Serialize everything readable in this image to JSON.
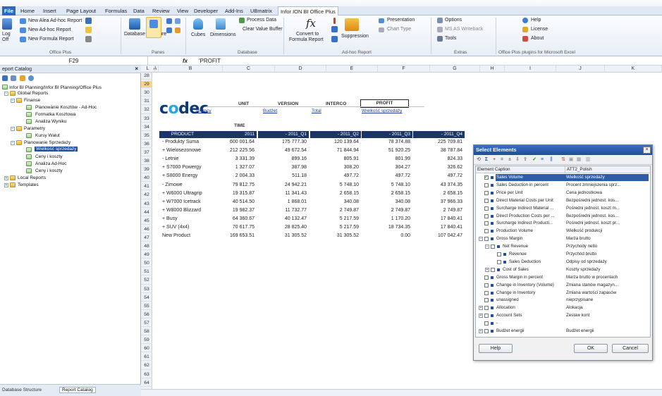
{
  "tabs": [
    "File",
    "Home",
    "Insert",
    "Page Layout",
    "Formulas",
    "Data",
    "Review",
    "View",
    "Developer",
    "Add-Ins",
    "UBmatrix",
    "Infor ION BI Office Plus"
  ],
  "ribbon": {
    "office_plus": {
      "new_alea": "New Alea Ad-hoc Report",
      "new_adhoc": "New Ad-hoc Report",
      "new_formula": "New Formula Report",
      "log": "Log",
      "off": "Off",
      "group": "Office Plus"
    },
    "panes": {
      "database_structure": "Database Structure",
      "report_catalog": "Report Catalog",
      "group": "Panes"
    },
    "database": {
      "cubes": "Cubes",
      "dimensions": "Dimensions",
      "process_data": "Process Data",
      "clear_value_buffer": "Clear Value Buffer",
      "group": "Database"
    },
    "adhoc": {
      "convert_to": "Convert to",
      "formula_report": "Formula Report",
      "suppression": "Suppression",
      "presentation": "Presentation",
      "chart_type": "Chart Type",
      "group": "Ad-hoc Report"
    },
    "extras": {
      "options": "Options",
      "ms_as_writeback": "MS AS Writeback",
      "tools": "Tools",
      "group": "Extras"
    },
    "help": {
      "help": "Help",
      "license": "License",
      "about": "About",
      "group": "Office Plus plugins for Microsoft Excel"
    }
  },
  "formula_bar": {
    "cell_ref": "F29",
    "fx": "fx",
    "value": "'PROFIT"
  },
  "report_catalog": {
    "title": "eport Catalog",
    "path": "Infor BI Planning/Infor BI Planning/Office Plus",
    "items": [
      "Global Reports",
      "Finanse",
      "Planowanie Kosztów - Ad-Hoc",
      "Formatka Kosztowa",
      "Analiza Wyniku",
      "Parametry",
      "Kursy Walut",
      "Planowanie Sprzedaży",
      "Wielkość sprzedaży",
      "Ceny i koszty",
      "Analiza Ad-Hoc",
      "Ceny i koszty",
      "Local Reports",
      "Templates"
    ],
    "bottom_tabs": [
      "Database Structure",
      "Report Catalog"
    ]
  },
  "columns": [
    "A",
    "B",
    "C",
    "D",
    "E",
    "F",
    "G",
    "H",
    "I",
    "J",
    "K",
    "L"
  ],
  "rows": [
    "28",
    "29",
    "30",
    "31",
    "32",
    "33",
    "34",
    "35",
    "36",
    "37",
    "38",
    "39",
    "40",
    "41",
    "42",
    "43",
    "44",
    "45",
    "46",
    "47",
    "48",
    "49",
    "50",
    "51",
    "52",
    "53",
    "54",
    "55",
    "56",
    "57",
    "58",
    "59",
    "60",
    "61",
    "62",
    "63",
    "64"
  ],
  "sheet": {
    "logo": "codec",
    "headers": {
      "unit": "UNIT",
      "version": "VERSION",
      "interco": "INTERCO",
      "profit": "PROFIT",
      "time": "TIME"
    },
    "links": {
      "unit": "Niemcy",
      "version": "Budżet",
      "interco": "Total",
      "profit": "Wielkość sprzedaży"
    },
    "table_header": [
      "PRODUCT",
      "2011",
      "- 2011_Q1",
      "- 2011_Q2",
      "- 2011_Q3",
      "- 2011_Q4"
    ],
    "table_rows": [
      [
        "- Produkty Suma",
        "600 001.64",
        "175 777.30",
        "120 139.64",
        "78 374.88",
        "225 709.81"
      ],
      [
        "+ Wielosezonowe",
        "212 225.56",
        "49 672.54",
        "71 844.94",
        "51 920.25",
        "38 787.84"
      ],
      [
        "- Letnie",
        "3 331.39",
        "899.16",
        "805.91",
        "801.99",
        "824.33"
      ],
      [
        "+ S7000 Powergy",
        "1 327.07",
        "387.98",
        "308.20",
        "304.27",
        "326.62"
      ],
      [
        "+ S8000 Energy",
        "2 004.33",
        "511.18",
        "497.72",
        "497.72",
        "497.72"
      ],
      [
        "- Zimowe",
        "79 812.75",
        "24 942.21",
        "5 748.10",
        "5 748.10",
        "43 374.35"
      ],
      [
        "+ W6000 Ultragrip",
        "19 315.87",
        "11 341.43",
        "2 658.15",
        "2 658.15",
        "2 658.15"
      ],
      [
        "+ W7000 Icetrack",
        "40 514.50",
        "1 868.01",
        "340.08",
        "340.08",
        "37 966.33"
      ],
      [
        "+ W8000 Blizzard",
        "19 982.37",
        "11 732.77",
        "2 749.87",
        "2 749.87",
        "2 749.87"
      ],
      [
        "+ Busy",
        "64 360.67",
        "40 132.47",
        "5 217.59",
        "1 170.20",
        "17 840.41"
      ],
      [
        "+ SUV (4x4)",
        "70 617.75",
        "28 825.40",
        "5 217.59",
        "18 734.35",
        "17 840.41"
      ],
      [
        "New Product",
        "169 653.51",
        "31 305.52",
        "31 305.52",
        "0.00",
        "107 042.47"
      ]
    ]
  },
  "dialog": {
    "title": "Select Elements",
    "col1": "Element Caption",
    "col2": "ATT2_Polish",
    "items": [
      [
        "Sales Volume",
        "Wielkość sprzedaży"
      ],
      [
        "Sales Deduction in percent",
        "Procent zmniejszenia sprz..."
      ],
      [
        "Price per Unit",
        "Cena jednostkowa"
      ],
      [
        "Direct Material Costs per Unit",
        "Bezpośredni jednost. kos..."
      ],
      [
        "Surcharge Indirect Material ...",
        "Pośredni jednost. koszt m..."
      ],
      [
        "Direct Production Costs per ...",
        "Bezpośredni jednost. kos..."
      ],
      [
        "Surcharge Indirect Producti...",
        "Pośredni jednost. koszt pr..."
      ],
      [
        "Production Volume",
        "Wielkość produkcji"
      ],
      [
        "Gross Margin",
        "Marża brutto"
      ],
      [
        "Net Revenue",
        "Przychody netto"
      ],
      [
        "Revenue",
        "Przychód brutto"
      ],
      [
        "Sales Deduction",
        "Odpisy od sprzedaży"
      ],
      [
        "Cost of Sales",
        "Koszty sprzedaży"
      ],
      [
        "Gross Margin in percent",
        "Marża brutto w procentach"
      ],
      [
        "Change in Inventory (Volume)",
        "Zmiana stanów magazyn..."
      ],
      [
        "Change in Inventory",
        "Zmiana wartości zapasów"
      ],
      [
        "unassigned",
        "nieprzypisane"
      ],
      [
        "Allocation",
        "Alokacja"
      ],
      [
        "Account Sets",
        "Zestaw kont"
      ],
      [
        "-",
        ""
      ],
      [
        "Budżet energii",
        "Budżet energii"
      ]
    ],
    "help": "Help",
    "ok": "OK",
    "cancel": "Cancel"
  },
  "colors": {
    "accent": "#1a3566",
    "selection": "#2e5ca9",
    "logo_dark": "#0c3b7a",
    "logo_light": "#2aa6dc"
  }
}
